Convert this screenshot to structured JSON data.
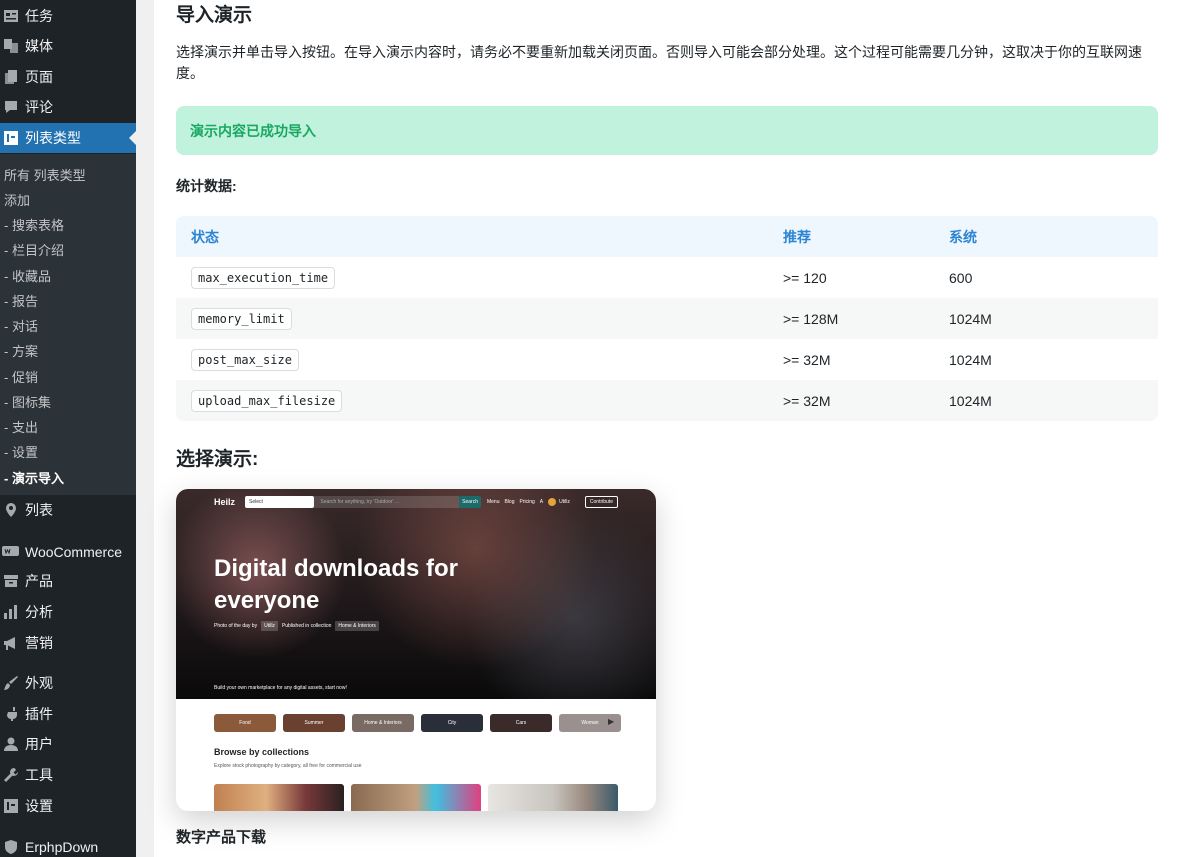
{
  "sidebar": {
    "menu": [
      {
        "id": "tasks",
        "label": "任务",
        "icon": "tasks-icon"
      },
      {
        "id": "media",
        "label": "媒体",
        "icon": "media-icon"
      },
      {
        "id": "pages",
        "label": "页面",
        "icon": "page-icon"
      },
      {
        "id": "comments",
        "label": "评论",
        "icon": "comment-icon"
      },
      {
        "id": "list-types",
        "label": "列表类型",
        "icon": "list-type-icon"
      },
      {
        "id": "listings",
        "label": "列表",
        "icon": "location-pin-icon"
      },
      {
        "id": "woocommerce",
        "label": "WooCommerce",
        "icon": "woocommerce-icon"
      },
      {
        "id": "products",
        "label": "产品",
        "icon": "product-icon"
      },
      {
        "id": "analytics",
        "label": "分析",
        "icon": "bar-chart-icon"
      },
      {
        "id": "marketing",
        "label": "营销",
        "icon": "megaphone-icon"
      },
      {
        "id": "appearance",
        "label": "外观",
        "icon": "paintbrush-icon"
      },
      {
        "id": "plugins",
        "label": "插件",
        "icon": "plugin-icon"
      },
      {
        "id": "users",
        "label": "用户",
        "icon": "user-icon"
      },
      {
        "id": "tools",
        "label": "工具",
        "icon": "wrench-icon"
      },
      {
        "id": "settings",
        "label": "设置",
        "icon": "settings-icon"
      },
      {
        "id": "erphpdown",
        "label": "ErphpDown",
        "icon": "shield-icon"
      }
    ],
    "submenu": [
      "所有 列表类型",
      "添加",
      "- 搜索表格",
      "- 栏目介绍",
      "- 收藏品",
      "- 报告",
      "- 对话",
      "- 方案",
      "- 促销",
      "- 图标集",
      "- 支出",
      "- 设置",
      "- 演示导入"
    ]
  },
  "main": {
    "heading": "导入演示",
    "intro": "选择演示并单击导入按钮。在导入演示内容时，请务必不要重新加载关闭页面。否则导入可能会部分处理。这个过程可能需要几分钟，这取决于你的互联网速度。",
    "notice": "演示内容已成功导入",
    "stats_heading": "统计数据:",
    "table": {
      "headers": [
        "状态",
        "推荐",
        "系统"
      ],
      "rows": [
        [
          "max_execution_time",
          ">= 120",
          "600"
        ],
        [
          "memory_limit",
          ">= 128M",
          "1024M"
        ],
        [
          "post_max_size",
          ">= 32M",
          "1024M"
        ],
        [
          "upload_max_filesize",
          ">= 32M",
          "1024M"
        ]
      ]
    },
    "choose_heading": "选择演示:",
    "demo": {
      "name": "数字产品下载",
      "preview": {
        "logo": "Heilz",
        "select": "Select",
        "search_placeholder": "Search for anything, try 'Outdoor' ...",
        "search_button": "Search",
        "nav_links": [
          "Menu",
          "Blog",
          "Pricing"
        ],
        "user_initial": "A",
        "user_name": "Utillz",
        "contribute": "Contribute",
        "title": "Digital downloads for everyone",
        "meta_prefix": "Photo of the day by",
        "meta_author": "Utillz",
        "meta_mid": "Published in collection",
        "meta_collection": "Home & Interiors",
        "tagline": "Build your own marketplace for any digital assets, start now!",
        "categories": [
          "Food",
          "Summer",
          "Home & Interiors",
          "City",
          "Cars",
          "Woman"
        ],
        "browse_title": "Browse by collections",
        "browse_sub": "Explore stock photography by category, all free for commercial use"
      }
    }
  }
}
